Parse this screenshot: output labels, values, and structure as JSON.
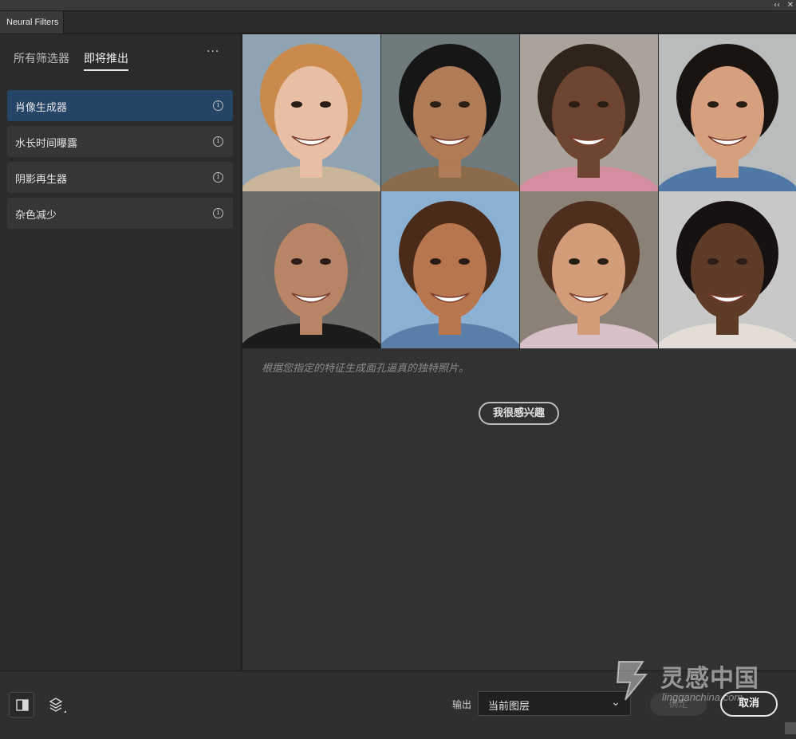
{
  "window": {
    "tab_title": "Neural Filters",
    "controls": {
      "collapse_label": "‹‹",
      "close_label": "✕"
    }
  },
  "sidebar": {
    "tabs": [
      {
        "label": "所有筛选器",
        "active": false
      },
      {
        "label": "即将推出",
        "active": true
      }
    ],
    "more_label": "···",
    "filters": [
      {
        "label": "肖像生成器",
        "selected": true
      },
      {
        "label": "水长时间曝露",
        "selected": false
      },
      {
        "label": "阴影再生器",
        "selected": false
      },
      {
        "label": "杂色减少",
        "selected": false
      }
    ],
    "info_glyph": "i"
  },
  "preview": {
    "faces": [
      {
        "name": "face-1",
        "bg": "#8fa3b3",
        "skin": "#e8bfa5",
        "hair": "#c98a4b",
        "shirt": "#c9b59a"
      },
      {
        "name": "face-2",
        "bg": "#6f7a7d",
        "skin": "#b07b57",
        "hair": "#161616",
        "shirt": "#8a6b4c"
      },
      {
        "name": "face-3",
        "bg": "#a9a39b",
        "skin": "#6e4530",
        "hair": "#2f231b",
        "shirt": "#d38ea0"
      },
      {
        "name": "face-4",
        "bg": "#b9bcbd",
        "skin": "#d6a07f",
        "hair": "#1a1411",
        "shirt": "#4f78a5"
      },
      {
        "name": "face-5",
        "bg": "#6e6c69",
        "skin": "#b78466",
        "hair": "#6b6a66",
        "shirt": "#1b1b1b"
      },
      {
        "name": "face-6",
        "bg": "#8bb1d2",
        "skin": "#b8764f",
        "hair": "#4a2b1a",
        "shirt": "#5a7ea8"
      },
      {
        "name": "face-7",
        "bg": "#8a8277",
        "skin": "#d29c79",
        "hair": "#4e2f1e",
        "shirt": "#d7c0c8"
      },
      {
        "name": "face-8",
        "bg": "#c8c8c6",
        "skin": "#5e3b27",
        "hair": "#171211",
        "shirt": "#e3ddd6"
      }
    ],
    "description": "根据您指定的特征生成面孔逼真的独特照片。",
    "interest_button": "我很感兴趣"
  },
  "footer": {
    "output_label": "输出",
    "output_value": "当前图层",
    "ok_label": "确定",
    "cancel_label": "取消"
  },
  "watermark": {
    "title": "灵感中国",
    "subtitle": "lingganchina.com"
  }
}
